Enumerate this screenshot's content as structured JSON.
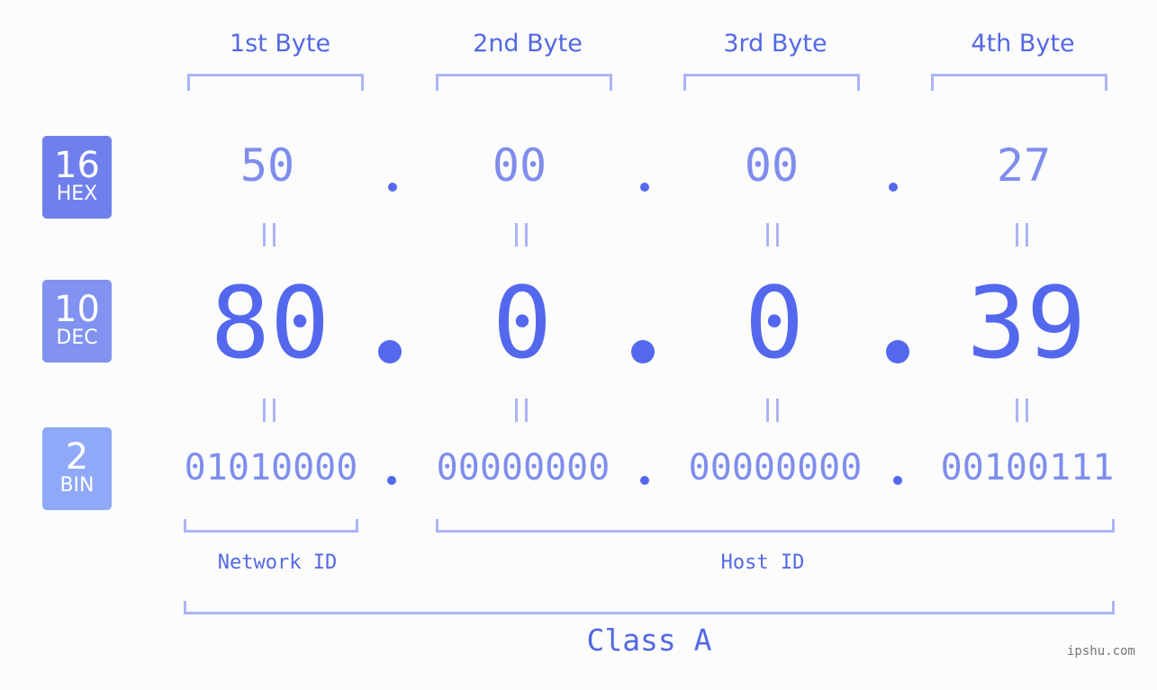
{
  "badges": [
    {
      "num": "16",
      "label": "HEX",
      "color": "#6f80ec"
    },
    {
      "num": "10",
      "label": "DEC",
      "color": "#8192f0"
    },
    {
      "num": "2",
      "label": "BIN",
      "color": "#8fa8f7"
    }
  ],
  "bytes": [
    {
      "label": "1st Byte",
      "hex": "50",
      "dec": "80",
      "bin": "01010000"
    },
    {
      "label": "2nd Byte",
      "hex": "00",
      "dec": "0",
      "bin": "00000000"
    },
    {
      "label": "3rd Byte",
      "hex": "00",
      "dec": "0",
      "bin": "00000000"
    },
    {
      "label": "4th Byte",
      "hex": "27",
      "dec": "39",
      "bin": "00100111"
    }
  ],
  "network_id_label": "Network ID",
  "host_id_label": "Host ID",
  "class_label": "Class A",
  "watermark": "ipshu.com"
}
